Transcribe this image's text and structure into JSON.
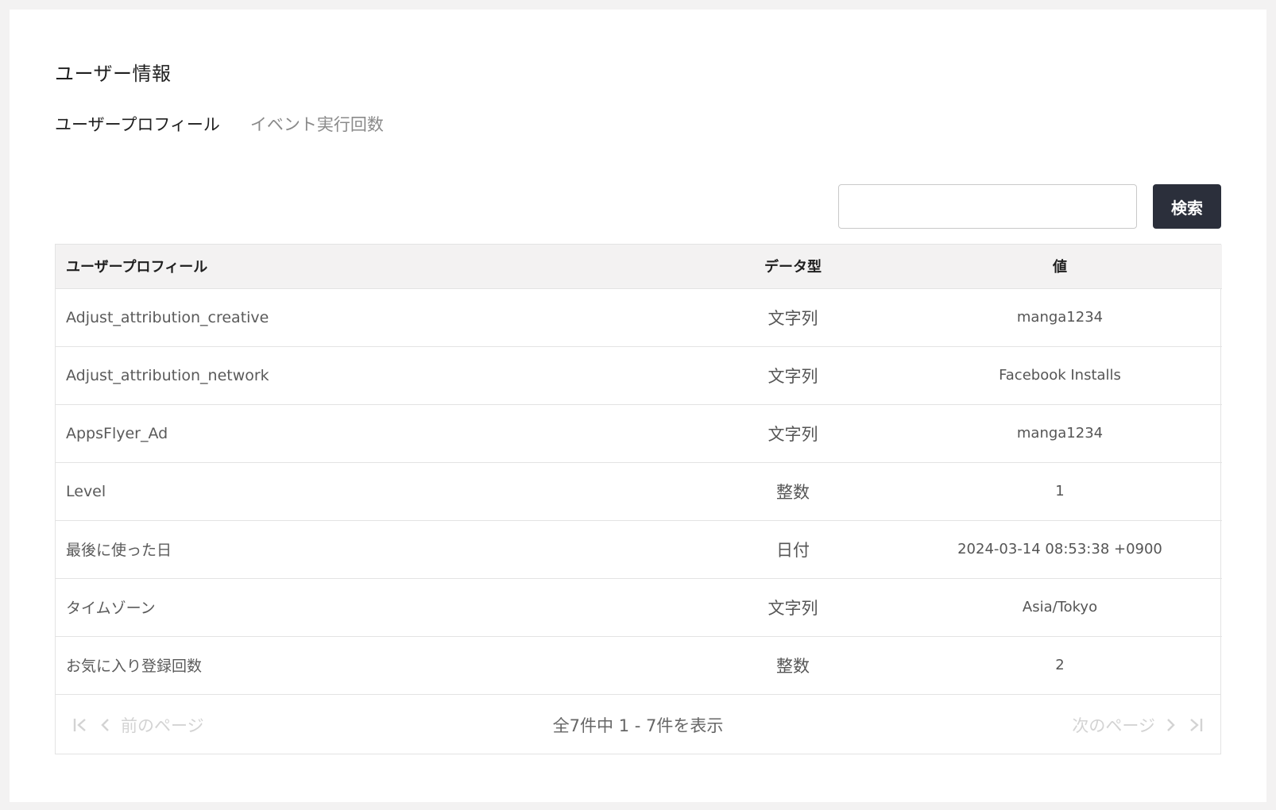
{
  "page": {
    "title": "ユーザー情報"
  },
  "tabs": [
    {
      "label": "ユーザープロフィール",
      "active": true
    },
    {
      "label": "イベント実行回数",
      "active": false
    }
  ],
  "search": {
    "value": "",
    "button_label": "検索"
  },
  "table": {
    "headers": {
      "name": "ユーザープロフィール",
      "type": "データ型",
      "value": "値"
    },
    "rows": [
      {
        "name": "Adjust_attribution_creative",
        "type": "文字列",
        "value": "manga1234"
      },
      {
        "name": "Adjust_attribution_network",
        "type": "文字列",
        "value": "Facebook Installs"
      },
      {
        "name": "AppsFlyer_Ad",
        "type": "文字列",
        "value": "manga1234"
      },
      {
        "name": "Level",
        "type": "整数",
        "value": "1"
      },
      {
        "name": "最後に使った日",
        "type": "日付",
        "value": "2024-03-14 08:53:38 +0900"
      },
      {
        "name": "タイムゾーン",
        "type": "文字列",
        "value": "Asia/Tokyo"
      },
      {
        "name": "お気に入り登録回数",
        "type": "整数",
        "value": "2"
      }
    ]
  },
  "pagination": {
    "prev_label": "前のページ",
    "next_label": "次のページ",
    "info": "全7件中 1 - 7件を表示",
    "icons": {
      "first": "first-page-icon",
      "prev": "chevron-left-icon",
      "next": "chevron-right-icon",
      "last": "last-page-icon"
    }
  },
  "colors": {
    "background": "#f3f2f2",
    "button": "#2b2f3b",
    "disabled": "#d3d3d3"
  }
}
